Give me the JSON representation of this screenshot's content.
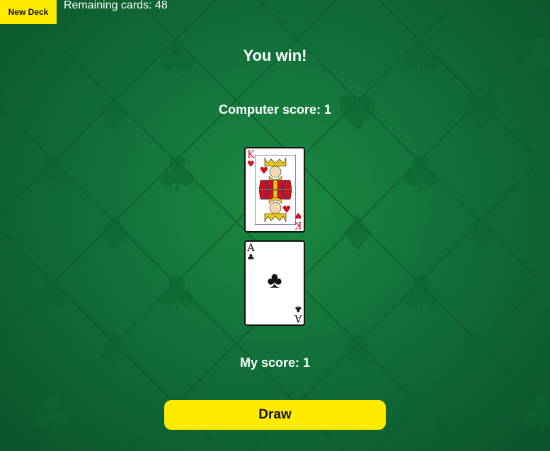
{
  "header": {
    "new_deck_label": "New Deck",
    "remaining_label": "Remaining cards: 48"
  },
  "game": {
    "result_text": "You win!",
    "computer_score_text": "Computer score: 1",
    "my_score_text": "My score: 1",
    "draw_label": "Draw"
  },
  "cards": {
    "computer": {
      "rank": "K",
      "suit": "♥",
      "suit_name": "hearts",
      "color": "#d20f1a"
    },
    "player": {
      "rank": "A",
      "suit": "♣",
      "suit_name": "clubs",
      "color": "#111111"
    }
  },
  "colors": {
    "accent_yellow": "#ffeb00",
    "table_green": "#12703a"
  }
}
